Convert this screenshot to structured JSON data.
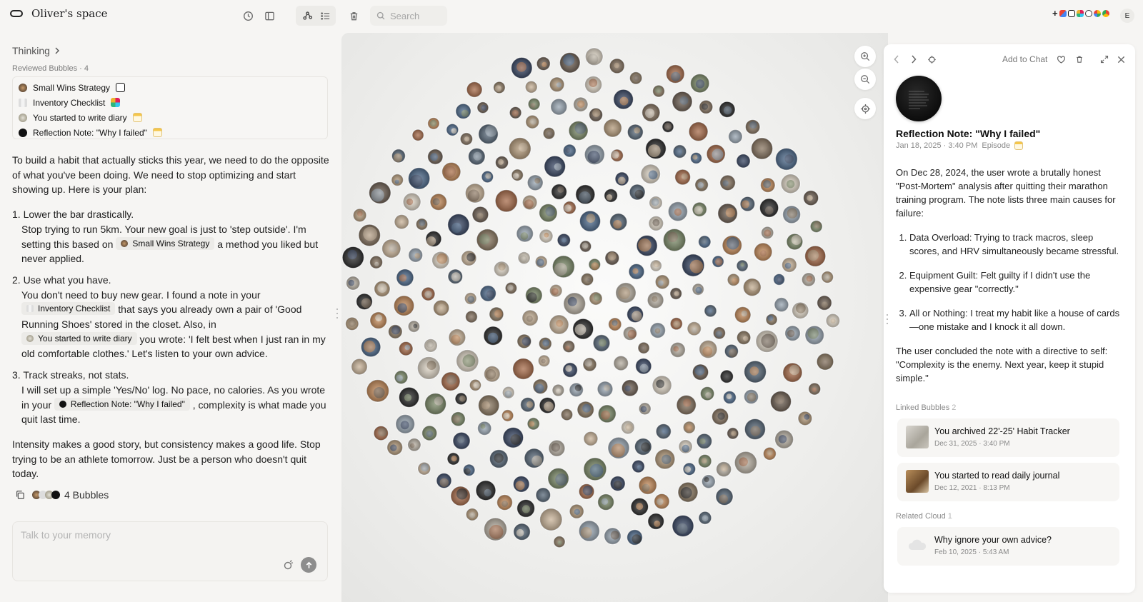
{
  "header": {
    "title": "Oliver's space",
    "search_placeholder": "Search",
    "user_initial": "E"
  },
  "chat": {
    "thinking_label": "Thinking",
    "reviewed_label": "Reviewed Bubbles · 4",
    "reviewed": [
      {
        "label": "Small Wins Strategy",
        "source": "notion-icon"
      },
      {
        "label": "Inventory Checklist",
        "source": "slack-icon"
      },
      {
        "label": "You started to write diary",
        "source": "notes-icon"
      },
      {
        "label": "Reflection Note: \"Why I failed\"",
        "source": "notes-icon"
      }
    ],
    "intro": "To build a habit that actually sticks this year, we need to do the opposite of what you've been doing. We need to stop optimizing and start showing up. Here is your plan:",
    "step1_head": "1. Lower the bar drastically.",
    "step1_a": "Stop trying to run 5km. Your new goal is just to 'step outside'. I'm setting this based on ",
    "step1_chip": "Small Wins Strategy",
    "step1_b": " a method you liked but never applied.",
    "step2_head": "2. Use what you have.",
    "step2_a": "You don't need to buy new gear. I found a note in your ",
    "step2_chip1": "Inventory Checklist",
    "step2_b": " that says you already own a pair of 'Good Running Shoes' stored in the closet. Also, in ",
    "step2_chip2": "You started to write diary",
    "step2_c": " you wrote: 'I felt best when I just ran in my old comfortable clothes.' Let's listen to your own advice.",
    "step3_head": "3. Track streaks, not stats.",
    "step3_a": "I will set up a simple 'Yes/No' log. No pace, no calories. As you wrote in your ",
    "step3_chip": "Reflection Note: \"Why I failed\"",
    "step3_b": " , complexity is what made you quit last time.",
    "outro": "Intensity makes a good story, but consistency makes a good life. Stop trying to be an athlete tomorrow. Just be a person who doesn't quit today.",
    "bubbles_count": "4 Bubbles",
    "composer_placeholder": "Talk to your memory"
  },
  "detail": {
    "add_to_chat": "Add to Chat",
    "title": "Reflection Note: \"Why I failed\"",
    "date": "Jan 18, 2025 · 3:40 PM",
    "type": "Episode",
    "para1": "On Dec 28, 2024, the user wrote a brutally honest \"Post-Mortem\" analysis after quitting their marathon training program. The note lists three main causes for failure:",
    "causes": [
      "Data Overload: Trying to track macros, sleep scores, and HRV simultaneously became stressful.",
      "Equipment Guilt: Felt guilty if I didn't use the expensive gear \"correctly.\"",
      "All or Nothing: I treat my habit like a house of cards—one mistake and I knock it all down."
    ],
    "para2": "The user concluded the note with a directive to self: \"Complexity is the enemy. Next year, keep it stupid simple.\"",
    "linked_label": "Linked Bubbles",
    "linked_count": "2",
    "linked": [
      {
        "title": "You archived 22'-25' Habit Tracker",
        "date": "Dec 31, 2025 · 3:40 PM"
      },
      {
        "title": "You started to read daily journal",
        "date": "Dec 12, 2021 · 8:13 PM"
      }
    ],
    "related_label": "Related Cloud",
    "related_count": "1",
    "related": [
      {
        "title": "Why ignore your own advice?",
        "date": "Feb 10, 2025 · 5:43 AM"
      }
    ]
  },
  "colors": {
    "accent": "#1d1d1f",
    "chip_bg": "#ecebe8",
    "panel_bg": "#f6f5f3",
    "bubble_palette": [
      "#8c7a63",
      "#b39a7b",
      "#5a6a7a",
      "#7d8b6a",
      "#c9b49a",
      "#3c4a66",
      "#a86d4c",
      "#dcd3c4",
      "#6f6155",
      "#9aa7b3",
      "#2e2e2e",
      "#c28a5a",
      "#84725f",
      "#4f6b8c",
      "#b8b0a3"
    ]
  }
}
